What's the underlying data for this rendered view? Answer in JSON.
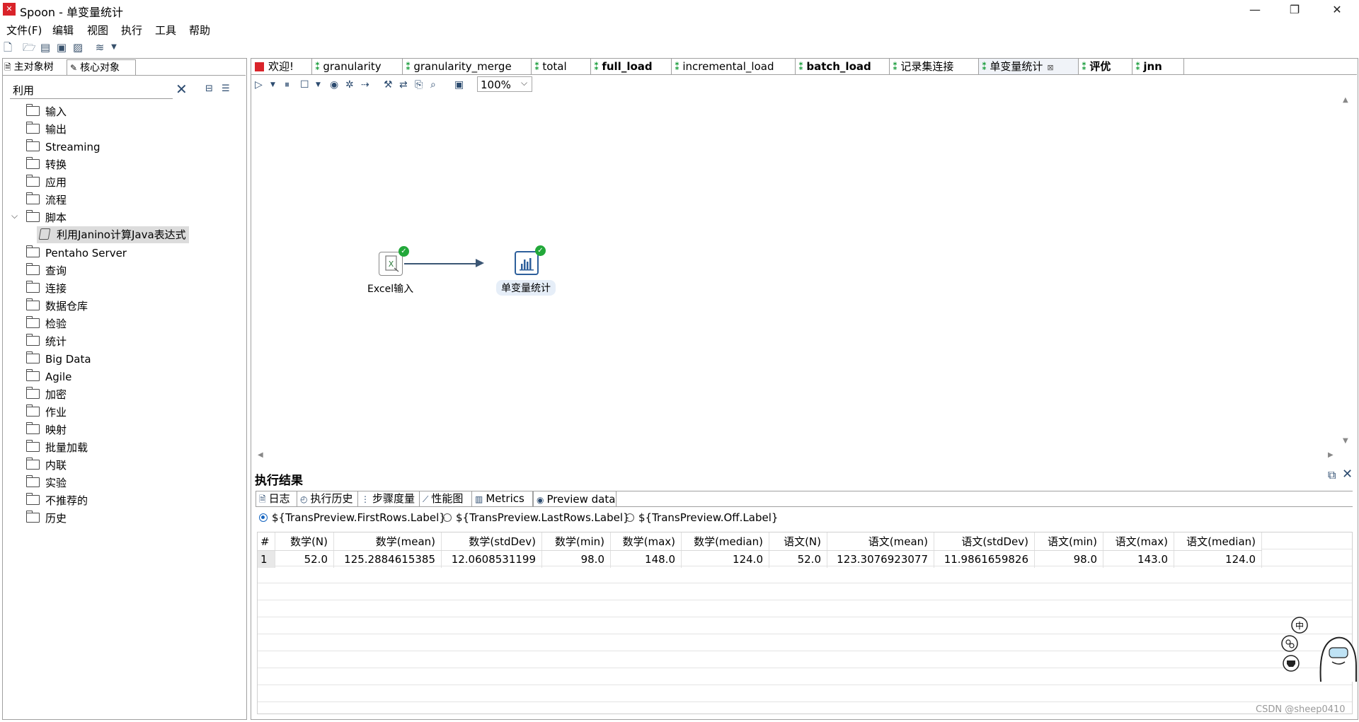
{
  "window": {
    "title": "Spoon - 单变量统计",
    "minimize": "—",
    "restore": "❐",
    "close": "✕"
  },
  "menu": [
    "文件(F)",
    "编辑",
    "视图",
    "执行",
    "工具",
    "帮助"
  ],
  "left_panel": {
    "tabs": [
      "主对象树",
      "核心对象"
    ],
    "search_value": "利用",
    "tree": [
      "输入",
      "输出",
      "Streaming",
      "转换",
      "应用",
      "流程",
      "脚本",
      "Pentaho Server",
      "查询",
      "连接",
      "数据仓库",
      "检验",
      "统计",
      "Big Data",
      "Agile",
      "加密",
      "作业",
      "映射",
      "批量加载",
      "内联",
      "实验",
      "不推荐的",
      "历史"
    ],
    "expanded_child": "利用Janino计算Java表达式"
  },
  "doc_tabs": [
    {
      "label": "欢迎!"
    },
    {
      "label": "granularity"
    },
    {
      "label": "granularity_merge"
    },
    {
      "label": "total"
    },
    {
      "label": "full_load"
    },
    {
      "label": "incremental_load"
    },
    {
      "label": "batch_load"
    },
    {
      "label": "记录集连接"
    },
    {
      "label": "单变量统计"
    },
    {
      "label": "评优"
    },
    {
      "label": "jnn"
    }
  ],
  "canvas": {
    "zoom": "100%",
    "steps": [
      {
        "label": "Excel输入",
        "icon": "excel-icon"
      },
      {
        "label": "单变量统计",
        "icon": "bar-chart-icon"
      }
    ]
  },
  "results": {
    "title": "执行结果",
    "tabs": [
      "日志",
      "执行历史",
      "步骤度量",
      "性能图",
      "Metrics",
      "Preview data"
    ],
    "radios": [
      "${TransPreview.FirstRows.Label}",
      "${TransPreview.LastRows.Label}",
      "${TransPreview.Off.Label}"
    ],
    "columns": [
      "#",
      "数学(N)",
      "数学(mean)",
      "数学(stdDev)",
      "数学(min)",
      "数学(max)",
      "数学(median)",
      "语文(N)",
      "语文(mean)",
      "语文(stdDev)",
      "语文(min)",
      "语文(max)",
      "语文(median)"
    ],
    "rows": [
      [
        "1",
        "52.0",
        "125.2884615385",
        "12.0608531199",
        "98.0",
        "148.0",
        "124.0",
        "52.0",
        "123.3076923077",
        "11.9861659826",
        "98.0",
        "143.0",
        "124.0"
      ]
    ]
  },
  "watermark": "CSDN @sheep0410",
  "sticker_text": "中"
}
